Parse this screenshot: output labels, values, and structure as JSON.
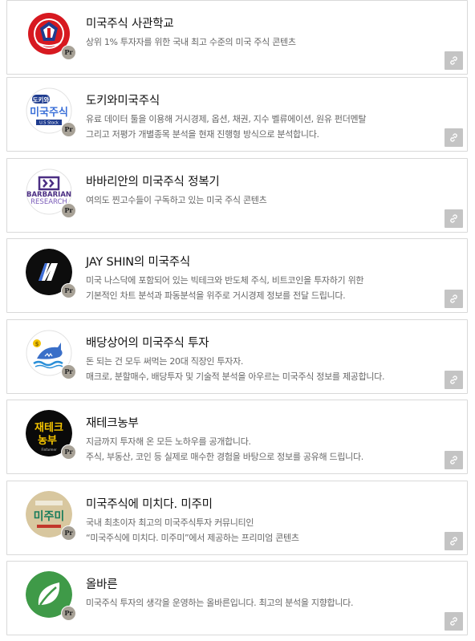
{
  "items": [
    {
      "title": "미국주식 사관학교",
      "desc1": "상위 1% 투자자를 위한 국내 최고 수준의 미국 주식 콘텐츠",
      "desc2": "",
      "badge": "Pr",
      "logo_icon": "us-stock-academy-crest-logo"
    },
    {
      "title": "도키와미국주식",
      "desc1": "유료 데이터 툴을 이용해 거시경제, 옵션, 채권, 지수 벨류에이션, 원유 펀더멘탈",
      "desc2": "그리고 저평가 개별종목 분석을 현재 진행형 방식으로 분석합니다.",
      "badge": "Pr",
      "logo_icon": "dokiwa-logo",
      "logo_text_top": "도키와",
      "logo_text_main": "미국주식",
      "logo_text_sub": "U.S Stock"
    },
    {
      "title": "바바리안의 미국주식 정복기",
      "desc1": "여의도 찐고수들이 구독하고 있는 미국 주식 콘텐츠",
      "desc2": "",
      "badge": "Pr",
      "logo_icon": "barbarian-research-logo",
      "logo_text_1": "BARBARIAN",
      "logo_text_2": "RESEARCH"
    },
    {
      "title": "JAY SHIN의 미국주식",
      "desc1": "미국 나스닥에 포함되어 있는 빅테크와 반도체 주식, 비트코인을 투자하기 위한",
      "desc2": "기본적인 차트 분석과 파동분석을 위주로 거시경제 정보를 전달 드립니다.",
      "badge": "Pr",
      "logo_icon": "jay-shin-logo"
    },
    {
      "title": "배당상어의 미국주식 투자",
      "desc1": "돈 되는 건 모두 써먹는 20대 직장인 투자자.",
      "desc2": "매크로, 분할매수, 배당투자 및 기술적 분석을 아우르는 미국주식 정보를 제공합니다.",
      "badge": "Pr",
      "logo_icon": "dividend-shark-logo"
    },
    {
      "title": "재테크농부",
      "desc1": "지금까지 투자해 온 모든 노하우를 공개합니다.",
      "desc2": "주식, 부동산, 코인 등 실제로 매수한 경험을 바탕으로 정보를 공유해 드립니다.",
      "badge": "Pr",
      "logo_icon": "finance-farmer-logo",
      "logo_text_1": "재테크",
      "logo_text_2": "농부",
      "logo_text_sub": "Finfarmer"
    },
    {
      "title": "미국주식에 미치다. 미주미",
      "desc1": "국내 최초이자 최고의 미국주식투자 커뮤니티인",
      "desc2": "“미국주식에 미치다. 미주미”에서 제공하는 프리미엄 콘텐츠",
      "badge": "Pr",
      "logo_icon": "mijumi-logo",
      "logo_text": "미주미"
    },
    {
      "title": "올바른",
      "desc1": "미국주식 투자의 생각을 운영하는 올바른입니다. 최고의 분석을 지향합니다.",
      "desc2": "",
      "badge": "Pr",
      "logo_icon": "olbareun-leaf-logo"
    }
  ],
  "link_icon": "link-icon",
  "colors": {
    "card_border": "#d9d9d9",
    "link_button_bg": "#c4c4c4",
    "title": "#111111",
    "description": "#666666",
    "badge_bg": "#a8a297"
  }
}
